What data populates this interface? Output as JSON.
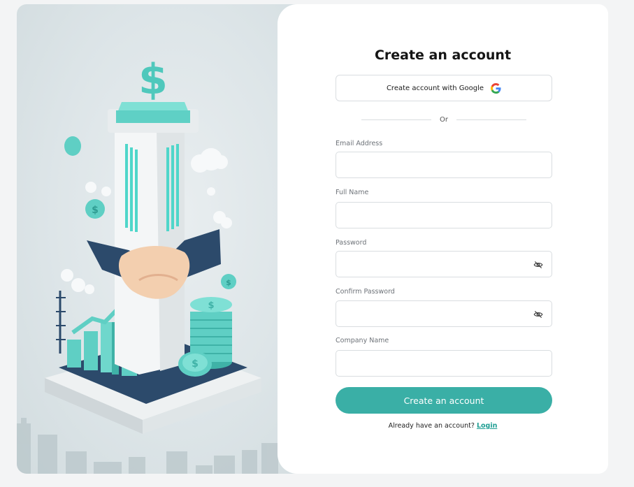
{
  "form": {
    "title": "Create an account",
    "google_button_label": "Create account with Google",
    "divider_text": "Or",
    "fields": [
      {
        "label": "Email Address",
        "value": "",
        "type": "email",
        "has_toggle": false
      },
      {
        "label": "Full Name",
        "value": "",
        "type": "text",
        "has_toggle": false
      },
      {
        "label": "Password",
        "value": "",
        "type": "password",
        "has_toggle": true
      },
      {
        "label": "Confirm Password",
        "value": "",
        "type": "password",
        "has_toggle": true
      },
      {
        "label": "Company Name",
        "value": "",
        "type": "text",
        "has_toggle": false
      }
    ],
    "submit_label": "Create an account",
    "login_prompt": "Already have an account?",
    "login_link": "Login"
  },
  "icons": {
    "google": "google-logo-icon",
    "password_toggle": "eye-slash-icon"
  },
  "colors": {
    "accent": "#3aafa6",
    "link": "#1e9e93",
    "border": "#d9dde0",
    "background": "#f3f4f5"
  }
}
